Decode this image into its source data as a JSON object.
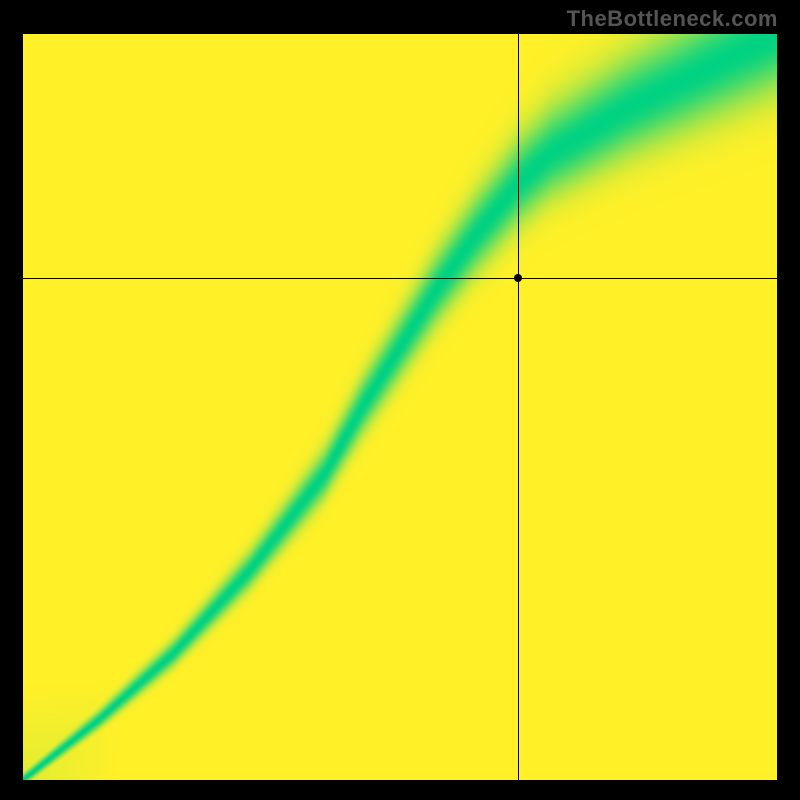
{
  "watermark": "TheBottleneck.com",
  "chart_data": {
    "type": "heatmap",
    "title": "",
    "xlabel": "",
    "ylabel": "",
    "xlim": [
      0,
      1
    ],
    "ylim": [
      0,
      1
    ],
    "grid": false,
    "legend": false,
    "colorscale_note": "Value 0 = red, 0.5 = yellow, 1.0 = green; background field is a diagonal red→yellow gradient, overlaid with a green S-curve ridge where bottleneck is minimal.",
    "crosshair": {
      "x": 0.657,
      "y": 0.672
    },
    "ridge_points": [
      {
        "x": 0.0,
        "y": 0.0
      },
      {
        "x": 0.1,
        "y": 0.08
      },
      {
        "x": 0.2,
        "y": 0.17
      },
      {
        "x": 0.3,
        "y": 0.28
      },
      {
        "x": 0.4,
        "y": 0.41
      },
      {
        "x": 0.45,
        "y": 0.5
      },
      {
        "x": 0.5,
        "y": 0.58
      },
      {
        "x": 0.55,
        "y": 0.66
      },
      {
        "x": 0.6,
        "y": 0.73
      },
      {
        "x": 0.657,
        "y": 0.8
      },
      {
        "x": 0.7,
        "y": 0.84
      },
      {
        "x": 0.8,
        "y": 0.9
      },
      {
        "x": 0.9,
        "y": 0.95
      },
      {
        "x": 1.0,
        "y": 1.0
      }
    ],
    "ridge_width_fraction_bottom": 0.015,
    "ridge_width_fraction_top": 0.15
  }
}
